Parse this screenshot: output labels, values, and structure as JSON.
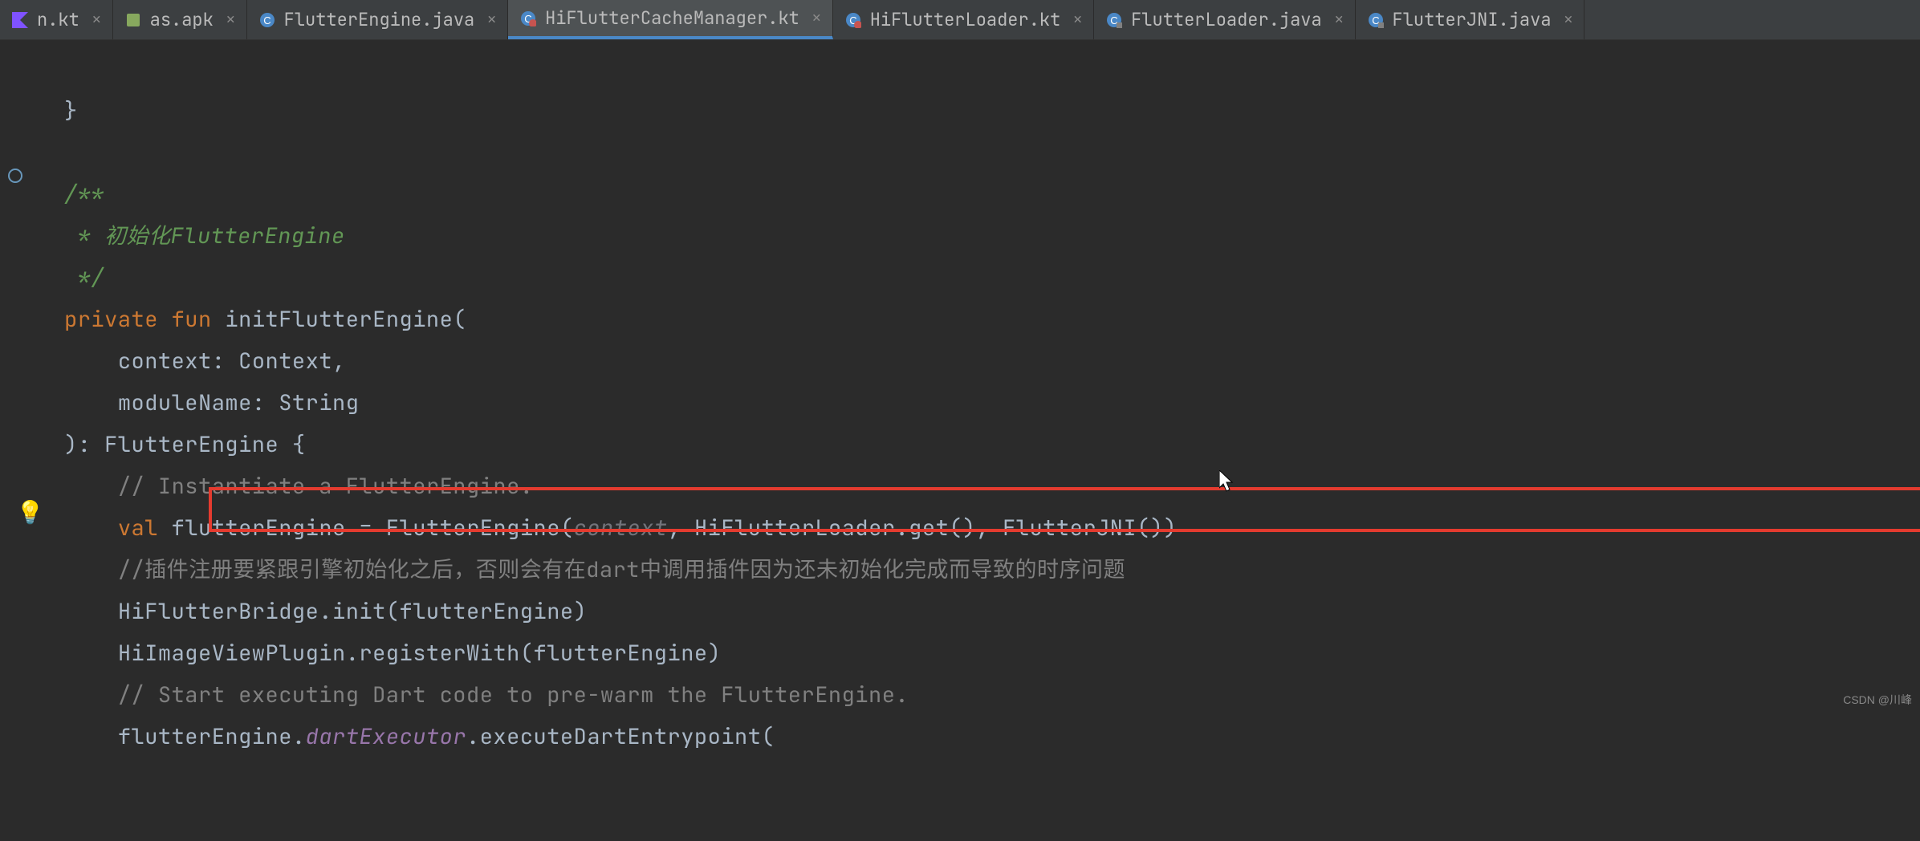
{
  "tabs": [
    {
      "label": "n.kt",
      "icon": "kotlin",
      "active": false
    },
    {
      "label": "as.apk",
      "icon": "apk",
      "active": false
    },
    {
      "label": "FlutterEngine.java",
      "icon": "java-class",
      "active": false
    },
    {
      "label": "HiFlutterCacheManager.kt",
      "icon": "kotlin-class",
      "active": true
    },
    {
      "label": "HiFlutterLoader.kt",
      "icon": "kotlin-class",
      "active": false
    },
    {
      "label": "FlutterLoader.java",
      "icon": "java-class",
      "active": false
    },
    {
      "label": "FlutterJNI.java",
      "icon": "java-class",
      "active": false
    }
  ],
  "code": {
    "brace_close": "}",
    "doc_open": "/**",
    "doc_line": " * 初始化FlutterEngine",
    "doc_close": " */",
    "private": "private",
    "fun": "fun",
    "method_name": "initFlutterEngine",
    "paren_open": "(",
    "param1_name": "context",
    "param1_type": "Context",
    "param2_name": "moduleName",
    "param2_type": "String",
    "return_type": "FlutterEngine",
    "brace_open": "{",
    "comment_instantiate": "// Instantiate a FlutterEngine.",
    "val": "val",
    "var_name": "flutterEngine",
    "equals": " = ",
    "ctor": "FlutterEngine",
    "arg_context": "context",
    "arg_loader": "HiFlutterLoader.get()",
    "arg_jni": "FlutterJNI()",
    "comment_plugin": "//插件注册要紧跟引擎初始化之后，否则会有在dart中调用插件因为还未初始化完成而导致的时序问题",
    "bridge_init": "HiFlutterBridge.init(flutterEngine)",
    "plugin_register": "HiImageViewPlugin.registerWith(flutterEngine)",
    "comment_start": "// Start executing Dart code to pre-warm the FlutterEngine.",
    "exec_prefix": "flutterEngine.",
    "exec_dartexecutor": "dartExecutor",
    "exec_suffix": ".executeDartEntrypoint("
  },
  "watermark": "CSDN @川峰"
}
